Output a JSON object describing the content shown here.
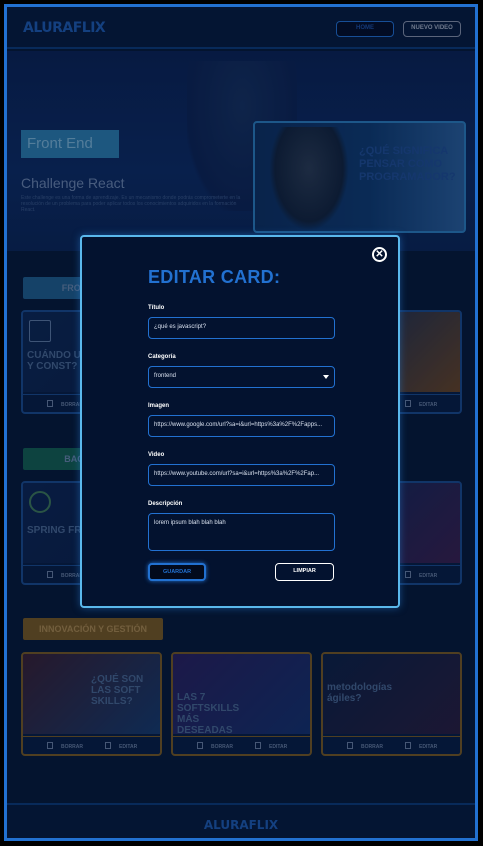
{
  "header": {
    "logo": "ALURAFLIX",
    "home_label": "HOME",
    "new_video_label": "NUEVO VIDEO"
  },
  "banner": {
    "category": "Front End",
    "title": "Challenge React",
    "description": "Este challenge es una forma de aprendizaje. Es un mecanismo donde podrás comprometerte en la resolución de un problema para poder aplicar todos los conocimientos adquiridos en la formación React.",
    "card_text": "¿QUÉ SIGNIFICA PENSAR COMO PROGRAMADOR?"
  },
  "sections": [
    {
      "label": "FRONT END",
      "color": "#2b7fae"
    },
    {
      "label": "BACK END",
      "color": "#1e8a6e"
    },
    {
      "label": "INNOVACIÓN Y GESTIÓN",
      "color": "#b8892a"
    }
  ],
  "cards": {
    "row1_left_title": "CUÁNDO USAR LET, VAR Y CONST?",
    "row2_left_title": "SPRING FRAMEWORK",
    "row3": [
      {
        "title": "¿QUÉ SON LAS SOFT SKILLS?"
      },
      {
        "title": "LAS 7 SOFTSKILLS MÁS DESEADAS"
      },
      {
        "title": "metodologías ágiles?"
      }
    ],
    "delete_label": "BORRAR",
    "edit_label": "EDITAR"
  },
  "modal": {
    "title": "EDITAR CARD:",
    "close_icon": "close-circle-icon",
    "fields": {
      "titulo": {
        "label": "Título",
        "value": "¿qué es javascript?"
      },
      "categoria": {
        "label": "Categoría",
        "value": "frontend"
      },
      "imagen": {
        "label": "Imagen",
        "value": "https://www.google.com/url?sa=i&url=https%3a%2F%2Fapps..."
      },
      "video": {
        "label": "Video",
        "value": "https://www.youtube.com/url?sa=i&url=https%3a%2F%2Fap..."
      },
      "descripcion": {
        "label": "Descripción",
        "value": "lorem ipsum blah blah blah"
      }
    },
    "save_label": "GUARDAR",
    "clear_label": "LIMPIAR"
  },
  "footer": {
    "logo": "ALURAFLIX"
  },
  "colors": {
    "accent": "#2271D1",
    "modal_border": "#5ab8ec",
    "background": "#061733"
  }
}
